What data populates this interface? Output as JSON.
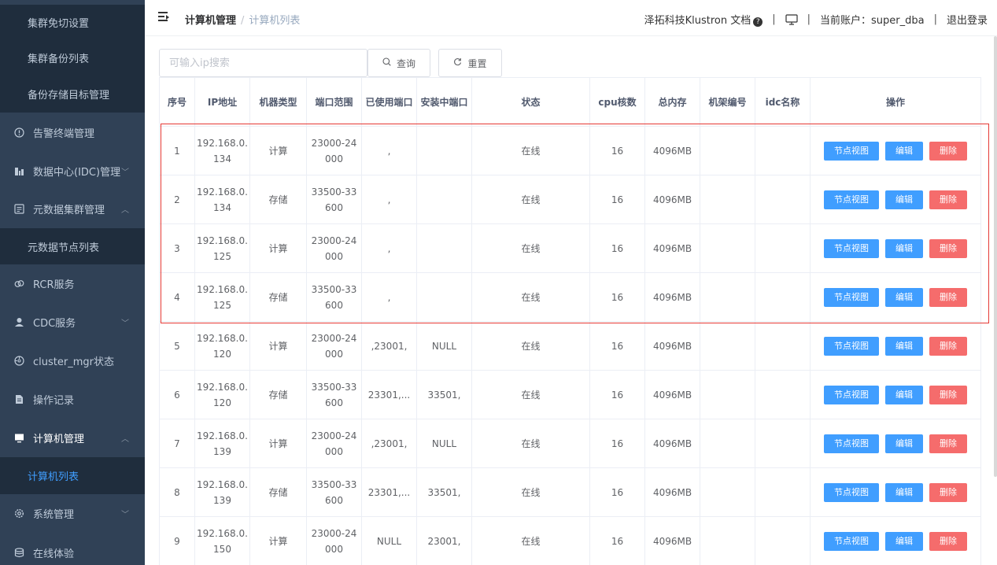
{
  "sidebar": {
    "items": [
      {
        "label": "集群免切设置",
        "type": "sub",
        "icon": "",
        "arrow": ""
      },
      {
        "label": "集群备份列表",
        "type": "sub",
        "icon": "",
        "arrow": ""
      },
      {
        "label": "备份存储目标管理",
        "type": "sub",
        "icon": "",
        "arrow": ""
      },
      {
        "label": "告警终端管理",
        "type": "top",
        "icon": "warning-circle-icon",
        "arrow": ""
      },
      {
        "label": "数据中心(IDC)管理",
        "type": "top",
        "icon": "bar-chart-icon",
        "arrow": "down"
      },
      {
        "label": "元数据集群管理",
        "type": "top",
        "icon": "metadata-icon",
        "arrow": "up"
      },
      {
        "label": "元数据节点列表",
        "type": "sub",
        "icon": "",
        "arrow": ""
      },
      {
        "label": "RCR服务",
        "type": "top",
        "icon": "link-icon",
        "arrow": ""
      },
      {
        "label": "CDC服务",
        "type": "top",
        "icon": "user-icon",
        "arrow": "down"
      },
      {
        "label": "cluster_mgr状态",
        "type": "top",
        "icon": "compass-icon",
        "arrow": ""
      },
      {
        "label": "操作记录",
        "type": "top",
        "icon": "document-icon",
        "arrow": ""
      },
      {
        "label": "计算机管理",
        "type": "top",
        "icon": "monitor-icon",
        "arrow": "up"
      },
      {
        "label": "计算机列表",
        "type": "sub",
        "icon": "",
        "arrow": "",
        "active": true
      },
      {
        "label": "系统管理",
        "type": "top",
        "icon": "gear-icon",
        "arrow": "down"
      },
      {
        "label": "在线体验",
        "type": "top",
        "icon": "database-icon",
        "arrow": ""
      }
    ]
  },
  "header": {
    "breadcrumb_1": "计算机管理",
    "breadcrumb_sep": "/",
    "breadcrumb_2": "计算机列表",
    "docs_link": "泽拓科技Klustron 文档",
    "account_label": "当前账户：super_dba",
    "logout": "退出登录"
  },
  "search": {
    "placeholder": "可输入ip搜索",
    "query_btn": "查询",
    "reset_btn": "重置"
  },
  "table": {
    "headers": [
      "序号",
      "IP地址",
      "机器类型",
      "端口范围",
      "已使用端口",
      "安装中端口",
      "状态",
      "cpu核数",
      "总内存",
      "机架编号",
      "idc名称",
      "操作"
    ],
    "rows": [
      {
        "idx": "1",
        "ip": "192.168.0.134",
        "type": "计算",
        "range": "23000-24000",
        "used": ",",
        "installing": "",
        "status": "在线",
        "cpu": "16",
        "mem": "4096MB",
        "rack": "",
        "idc": ""
      },
      {
        "idx": "2",
        "ip": "192.168.0.134",
        "type": "存储",
        "range": "33500-33600",
        "used": ",",
        "installing": "",
        "status": "在线",
        "cpu": "16",
        "mem": "4096MB",
        "rack": "",
        "idc": ""
      },
      {
        "idx": "3",
        "ip": "192.168.0.125",
        "type": "计算",
        "range": "23000-24000",
        "used": ",",
        "installing": "",
        "status": "在线",
        "cpu": "16",
        "mem": "4096MB",
        "rack": "",
        "idc": ""
      },
      {
        "idx": "4",
        "ip": "192.168.0.125",
        "type": "存储",
        "range": "33500-33600",
        "used": ",",
        "installing": "",
        "status": "在线",
        "cpu": "16",
        "mem": "4096MB",
        "rack": "",
        "idc": ""
      },
      {
        "idx": "5",
        "ip": "192.168.0.120",
        "type": "计算",
        "range": "23000-24000",
        "used": ",23001,",
        "installing": "NULL",
        "status": "在线",
        "cpu": "16",
        "mem": "4096MB",
        "rack": "",
        "idc": ""
      },
      {
        "idx": "6",
        "ip": "192.168.0.120",
        "type": "存储",
        "range": "33500-33600",
        "used": "23301,...",
        "installing": "33501,",
        "status": "在线",
        "cpu": "16",
        "mem": "4096MB",
        "rack": "",
        "idc": ""
      },
      {
        "idx": "7",
        "ip": "192.168.0.139",
        "type": "计算",
        "range": "23000-24000",
        "used": ",23001,",
        "installing": "NULL",
        "status": "在线",
        "cpu": "16",
        "mem": "4096MB",
        "rack": "",
        "idc": ""
      },
      {
        "idx": "8",
        "ip": "192.168.0.139",
        "type": "存储",
        "range": "33500-33600",
        "used": "23301,...",
        "installing": "33501,",
        "status": "在线",
        "cpu": "16",
        "mem": "4096MB",
        "rack": "",
        "idc": ""
      },
      {
        "idx": "9",
        "ip": "192.168.0.150",
        "type": "计算",
        "range": "23000-24000",
        "used": "NULL",
        "installing": "23001,",
        "status": "在线",
        "cpu": "16",
        "mem": "4096MB",
        "rack": "",
        "idc": ""
      }
    ],
    "actions": {
      "view": "节点视图",
      "edit": "编辑",
      "delete": "删除"
    }
  },
  "colors": {
    "sidebar_bg": "#304156",
    "sub_bg": "#1f2d3d",
    "primary": "#409eff",
    "danger": "#f56c6c",
    "online": "#13ce66",
    "highlight": "#e53935"
  }
}
